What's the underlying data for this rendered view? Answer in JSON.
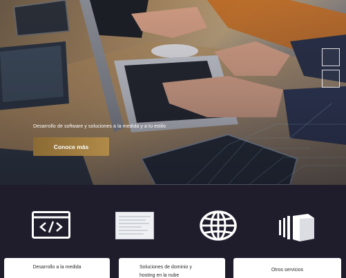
{
  "hero": {
    "tagline": "Desarrollo de software y soluciones a la medida y a tu estilo",
    "cta_label": "Conoce más"
  },
  "services": [
    {
      "label": "Desarrollo a la medida",
      "icon": "code-window-icon"
    },
    {
      "label": "Soluciones de dominio y hosting en la nube",
      "icon": "document-icon"
    },
    {
      "label": "Otros servicios",
      "icon": "globe-icon"
    }
  ],
  "extra_icon": "cube-icon",
  "colors": {
    "accent": "#b08a48",
    "section_bg": "#1f1c2c",
    "card_bg": "#ffffff"
  }
}
